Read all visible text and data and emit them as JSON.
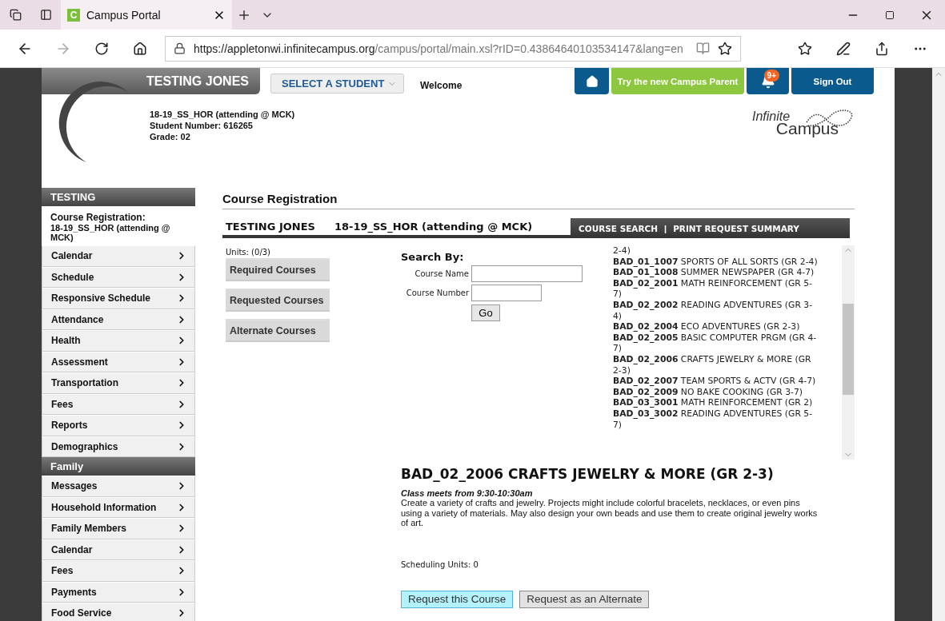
{
  "browser": {
    "tab_title": "Campus Portal",
    "favicon_letter": "C",
    "url_host": "https://appletonwi.infinitecampus.org",
    "url_path": "/campus/portal/main.xsl?rID=0.43864640103534147&lang=en"
  },
  "header": {
    "student_name": "TESTING JONES",
    "select_label": "SELECT A STUDENT",
    "welcome": "Welcome",
    "new_parent_button": "Try the new Campus Parent",
    "notification_count": "9+",
    "sign_out": "Sign Out",
    "info_lines": [
      "18-19_SS_HOR (attending @ MCK)",
      "Student Number: 616265",
      "Grade: 02"
    ],
    "logo_top": "Infinite",
    "logo_bottom": "Campus"
  },
  "sidebar": {
    "sections": [
      {
        "title": "TESTING",
        "current": "Course Registration:",
        "current_detail": "18-19_SS_HOR (attending @ MCK)",
        "items": [
          "Calendar",
          "Schedule",
          "Responsive Schedule",
          "Attendance",
          "Health",
          "Assessment",
          "Transportation",
          "Fees",
          "Reports",
          "Demographics"
        ]
      },
      {
        "title": "Family",
        "items": [
          "Messages",
          "Household Information",
          "Family Members",
          "Calendar",
          "Fees",
          "Payments",
          "Food Service"
        ]
      }
    ]
  },
  "page_title": "Course Registration",
  "bar": {
    "student": "TESTING JONES",
    "calendar": "18-19_SS_HOR (attending @ MCK)",
    "links": [
      "COURSE SEARCH",
      "PRINT REQUEST SUMMARY"
    ],
    "separator": "|"
  },
  "units": "Units: (0/3)",
  "course_buttons": [
    "Required Courses",
    "Requested Courses",
    "Alternate Courses"
  ],
  "search": {
    "title": "Search By:",
    "fields": [
      {
        "label": "Course Name",
        "kind": "wide"
      },
      {
        "label": "Course Number",
        "kind": "narrow"
      }
    ],
    "go": "Go"
  },
  "course_list": {
    "cut_line": "2-4)",
    "items": [
      {
        "code": "BAD_01_1007",
        "name": "SPORTS OF ALL SORTS (GR 2-4)"
      },
      {
        "code": "BAD_01_1008",
        "name": "SUMMER NEWSPAPER (GR 4-7)"
      },
      {
        "code": "BAD_02_2001",
        "name": "MATH REINFORCEMENT (GR 5-7)"
      },
      {
        "code": "BAD_02_2002",
        "name": "READING ADVENTURES (GR 3-4)"
      },
      {
        "code": "BAD_02_2004",
        "name": "ECO ADVENTURES (GR 2-3)"
      },
      {
        "code": "BAD_02_2005",
        "name": "BASIC COMPUTER PRGM (GR 4-7)"
      },
      {
        "code": "BAD_02_2006",
        "name": "CRAFTS JEWELRY & MORE (GR 2-3)"
      },
      {
        "code": "BAD_02_2007",
        "name": "TEAM SPORTS & ACTV (GR 4-7)"
      },
      {
        "code": "BAD_02_2009",
        "name": "NO BAKE COOKING (GR 3-7)"
      },
      {
        "code": "BAD_03_3001",
        "name": "MATH REINFORCEMENT (GR 2)"
      },
      {
        "code": "BAD_03_3002",
        "name": "READING ADVENTURES (GR 5-7)"
      }
    ]
  },
  "detail": {
    "title": "BAD_02_2006 CRAFTS JEWELRY & MORE (GR 2-3)",
    "meets": "Class meets from 9:30-10:30am",
    "description": "Create a variety of crafts and jewelry. Projects might include colorful bracelets, necklaces, or even pins using a variety of materials. May also design your own beads and use them to create original jewelry works of art.",
    "units": "Scheduling Units: 0",
    "actions": [
      {
        "label": "Request this Course",
        "kind": "primary"
      },
      {
        "label": "Request as an Alternate",
        "kind": "default"
      }
    ]
  }
}
